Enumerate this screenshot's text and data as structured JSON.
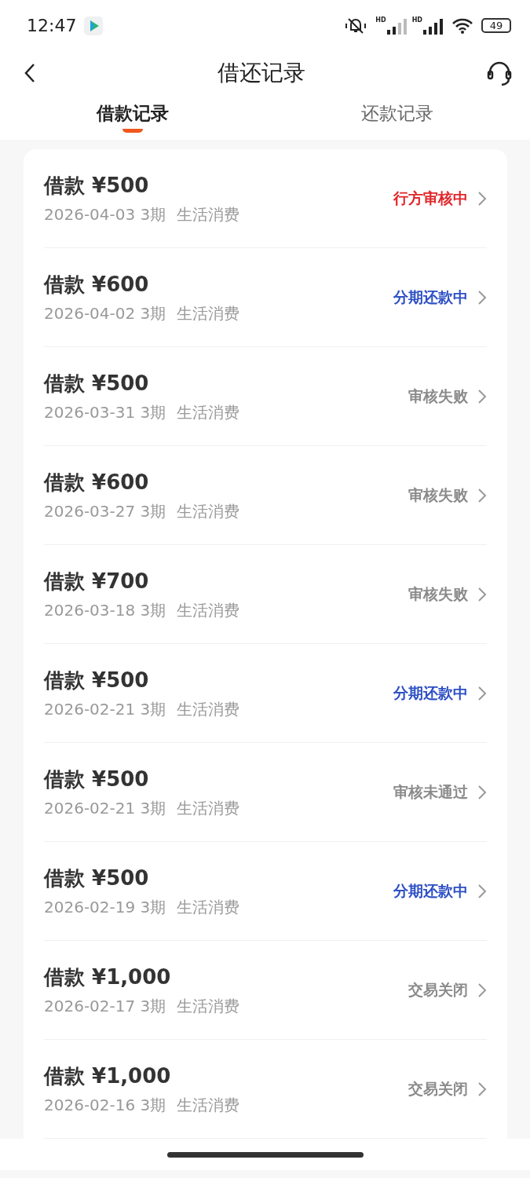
{
  "status_bar": {
    "time": "12:47",
    "signal_labels": [
      "HD",
      "HD"
    ],
    "battery": "49"
  },
  "nav": {
    "title": "借还记录"
  },
  "tabs": [
    {
      "label": "借款记录",
      "selected": true
    },
    {
      "label": "还款记录",
      "selected": false
    }
  ],
  "records": [
    {
      "amount": "借款 ¥500",
      "date": "2026-04-03 3期",
      "purpose": "生活消费",
      "status": "行方审核中",
      "kind": "alert"
    },
    {
      "amount": "借款 ¥600",
      "date": "2026-04-02 3期",
      "purpose": "生活消费",
      "status": "分期还款中",
      "kind": "active"
    },
    {
      "amount": "借款 ¥500",
      "date": "2026-03-31 3期",
      "purpose": "生活消费",
      "status": "审核失败",
      "kind": "done"
    },
    {
      "amount": "借款 ¥600",
      "date": "2026-03-27 3期",
      "purpose": "生活消费",
      "status": "审核失败",
      "kind": "done"
    },
    {
      "amount": "借款 ¥700",
      "date": "2026-03-18 3期",
      "purpose": "生活消费",
      "status": "审核失败",
      "kind": "done"
    },
    {
      "amount": "借款 ¥500",
      "date": "2026-02-21 3期",
      "purpose": "生活消费",
      "status": "分期还款中",
      "kind": "active"
    },
    {
      "amount": "借款 ¥500",
      "date": "2026-02-21 3期",
      "purpose": "生活消费",
      "status": "审核未通过",
      "kind": "done"
    },
    {
      "amount": "借款 ¥500",
      "date": "2026-02-19 3期",
      "purpose": "生活消费",
      "status": "分期还款中",
      "kind": "active"
    },
    {
      "amount": "借款 ¥1,000",
      "date": "2026-02-17 3期",
      "purpose": "生活消费",
      "status": "交易关闭",
      "kind": "done"
    },
    {
      "amount": "借款 ¥1,000",
      "date": "2026-02-16 3期",
      "purpose": "生活消费",
      "status": "交易关闭",
      "kind": "done"
    }
  ]
}
